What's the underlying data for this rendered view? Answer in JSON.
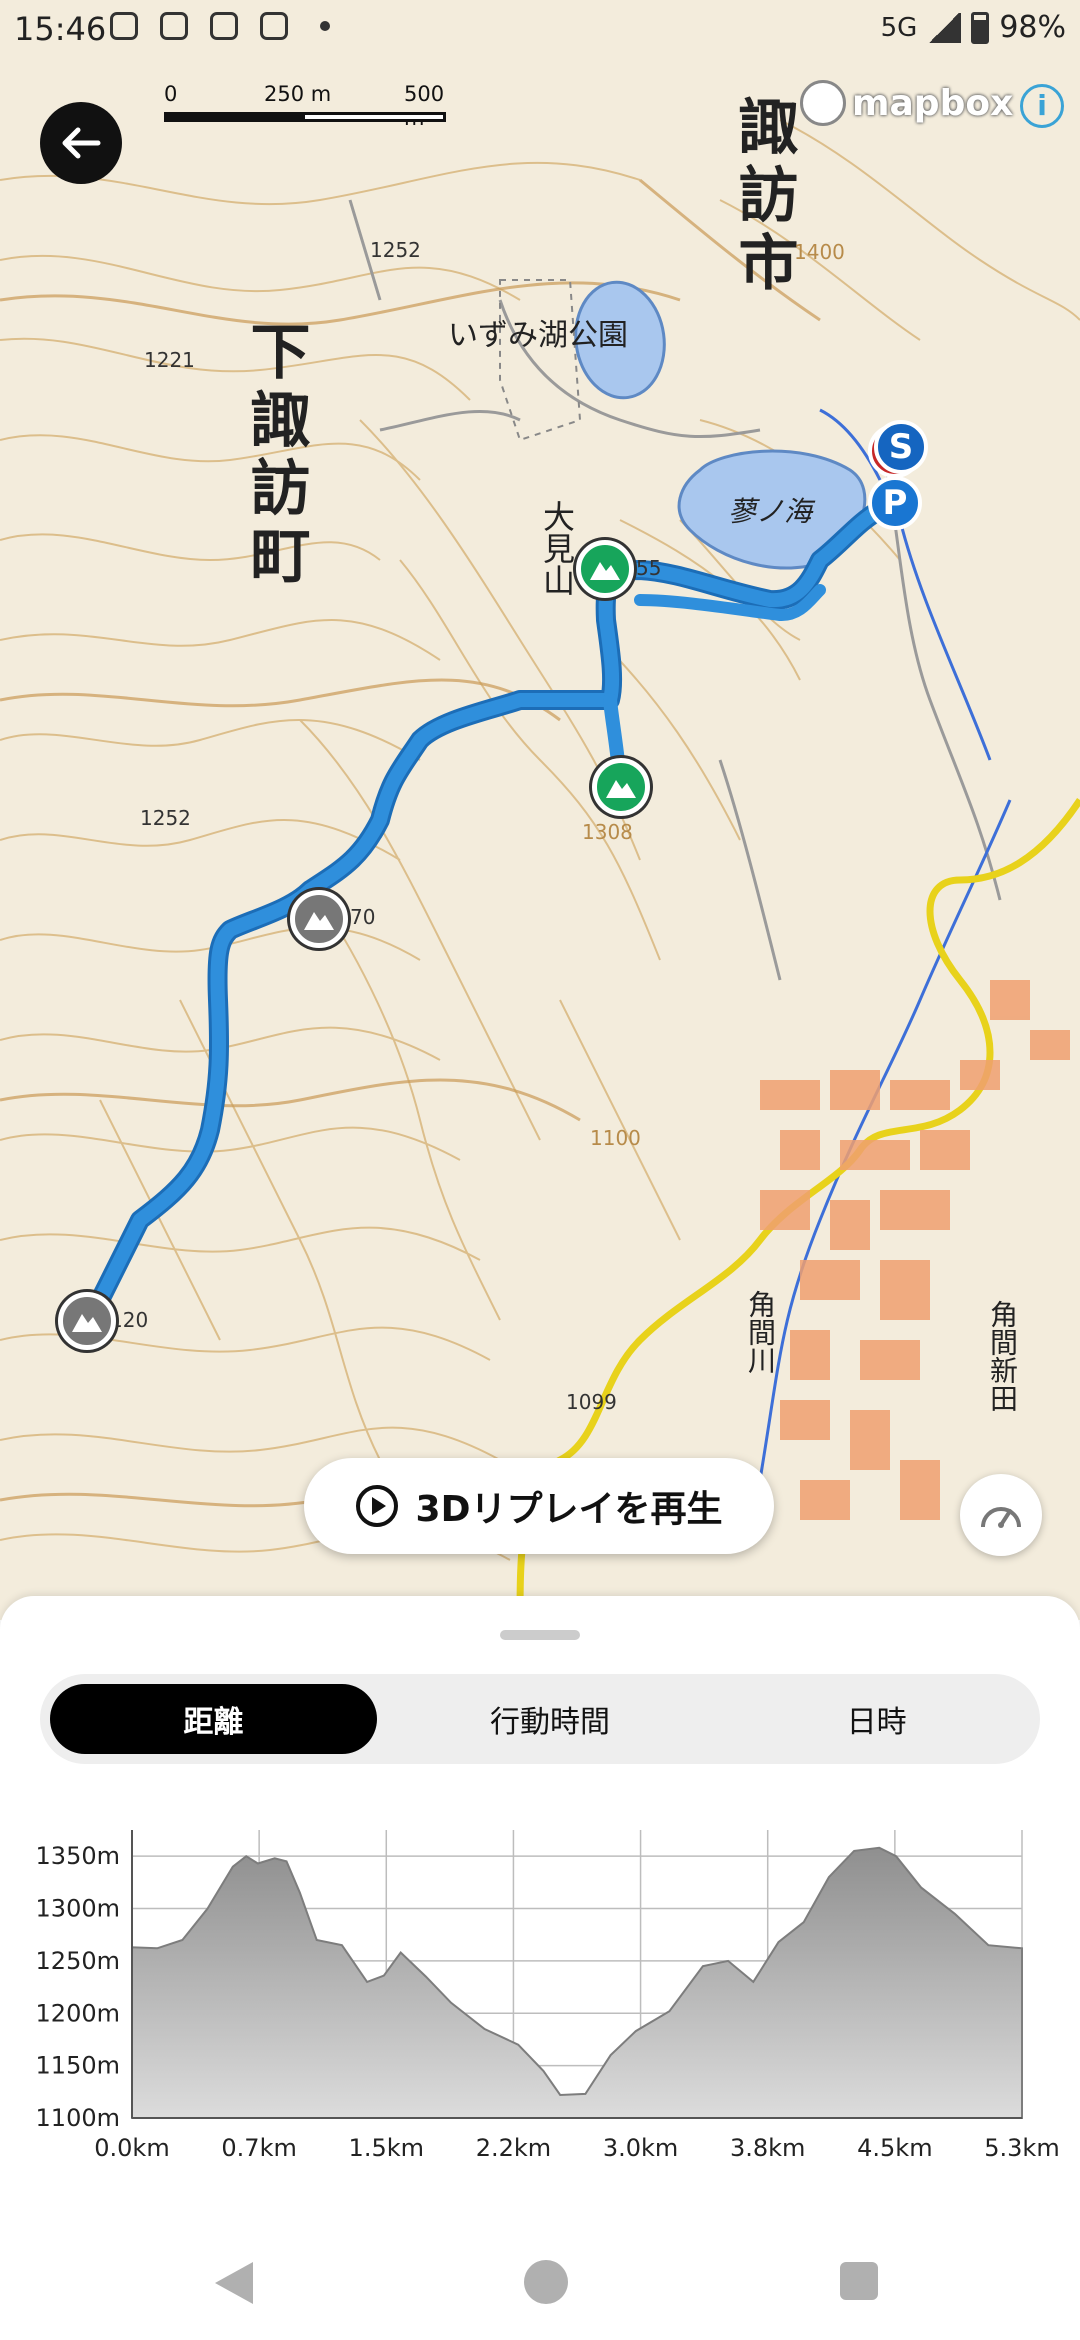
{
  "status": {
    "time": "15:46",
    "network": "5G",
    "battery": "98%"
  },
  "map": {
    "scale": {
      "zero": "0",
      "mid": "250 m",
      "end": "500 m"
    },
    "attribution": "mapbox",
    "labels": {
      "city_suwa": "諏訪市",
      "town_shimosuwa": "下諏訪町",
      "park": "いずみ湖公園",
      "lake": "蓼ノ海",
      "mountain": "大見山",
      "river": "角間川",
      "district": "角間新田"
    },
    "elevations": {
      "e1252a": "1252",
      "e1221": "1221",
      "e1252b": "1252",
      "e1099": "1099",
      "e1100": "1100",
      "e1308": "1308",
      "e1400": "1400",
      "e55": "55",
      "e70": "70",
      "e120": "120"
    },
    "pins": {
      "start": "S",
      "parking": "P"
    }
  },
  "replay_label": "3Dリプレイを再生",
  "tabs": [
    "距離",
    "行動時間",
    "日時"
  ],
  "colors": {
    "route": "#2f8fdc",
    "summit_green": "#17a55b",
    "area_fill": "#a9a9a9"
  },
  "chart_data": {
    "type": "area",
    "ylabels": [
      "1350m",
      "1300m",
      "1250m",
      "1200m",
      "1150m",
      "1100m"
    ],
    "xlabels": [
      "0.0km",
      "0.7km",
      "1.5km",
      "2.2km",
      "3.0km",
      "3.8km",
      "4.5km",
      "5.3km"
    ],
    "ylim": [
      1100,
      1375
    ],
    "xlim": [
      0,
      5.3
    ],
    "grid": true,
    "series": [
      {
        "x": [
          0,
          0.15,
          0.3,
          0.45,
          0.6,
          0.68,
          0.75,
          0.85,
          0.92,
          1.0,
          1.1,
          1.25,
          1.4,
          1.5,
          1.6,
          1.75,
          1.9,
          2.1,
          2.3,
          2.45,
          2.55,
          2.7,
          2.85,
          3.0,
          3.2,
          3.4,
          3.55,
          3.7,
          3.85,
          4.0,
          4.15,
          4.3,
          4.45,
          4.55,
          4.7,
          4.9,
          5.1,
          5.3
        ],
        "y": [
          1263,
          1262,
          1270,
          1300,
          1340,
          1350,
          1343,
          1348,
          1345,
          1315,
          1270,
          1265,
          1230,
          1236,
          1258,
          1235,
          1210,
          1185,
          1170,
          1145,
          1122,
          1123,
          1160,
          1183,
          1202,
          1245,
          1250,
          1230,
          1268,
          1287,
          1330,
          1355,
          1358,
          1350,
          1320,
          1295,
          1265,
          1262
        ]
      }
    ]
  }
}
